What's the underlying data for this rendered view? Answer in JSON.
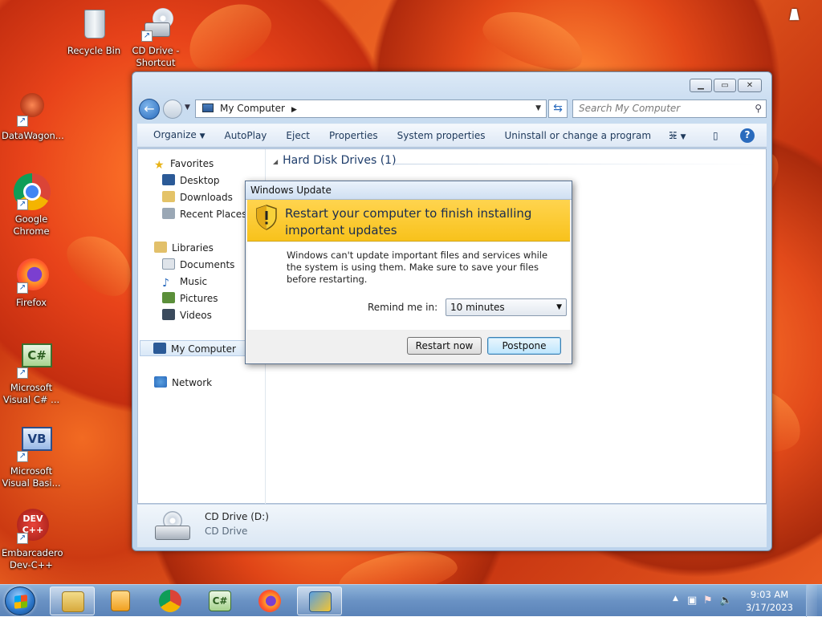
{
  "desktop": {
    "icons": [
      {
        "label": "Recycle Bin"
      },
      {
        "label": "CD Drive - Shortcut"
      },
      {
        "label": "DataWagon..."
      },
      {
        "label": "Google Chrome"
      },
      {
        "label": "Firefox"
      },
      {
        "label": "Microsoft Visual C# ..."
      },
      {
        "label": "Microsoft Visual Basi..."
      },
      {
        "label": "Embarcadero Dev-C++"
      }
    ]
  },
  "explorer": {
    "address": "My Computer",
    "search_placeholder": "Search My Computer",
    "toolbar": [
      "Organize",
      "AutoPlay",
      "Eject",
      "Properties",
      "System properties",
      "Uninstall or change a program"
    ],
    "toolbar_more": "»",
    "nav": {
      "favorites": "Favorites",
      "desktop": "Desktop",
      "downloads": "Downloads",
      "recent": "Recent Places",
      "libraries": "Libraries",
      "documents": "Documents",
      "music": "Music",
      "pictures": "Pictures",
      "videos": "Videos",
      "computer": "My Computer",
      "network": "Network"
    },
    "group_header": "Hard Disk Drives (1)",
    "details": {
      "name": "CD Drive (D:)",
      "type": "CD Drive"
    }
  },
  "dialog": {
    "title": "Windows Update",
    "heading": "Restart your computer to finish installing important updates",
    "message": "Windows can't update important files and services while the system is using them. Make sure to save your files before restarting.",
    "remind_label": "Remind me in:",
    "remind_value": "10 minutes",
    "restart_button": "Restart now",
    "postpone_button": "Postpone"
  },
  "taskbar": {
    "time": "9:03 AM",
    "date": "3/17/2023"
  },
  "colors": {
    "dialog_header": "#f8c21c",
    "accent": "#2a6bbd"
  }
}
